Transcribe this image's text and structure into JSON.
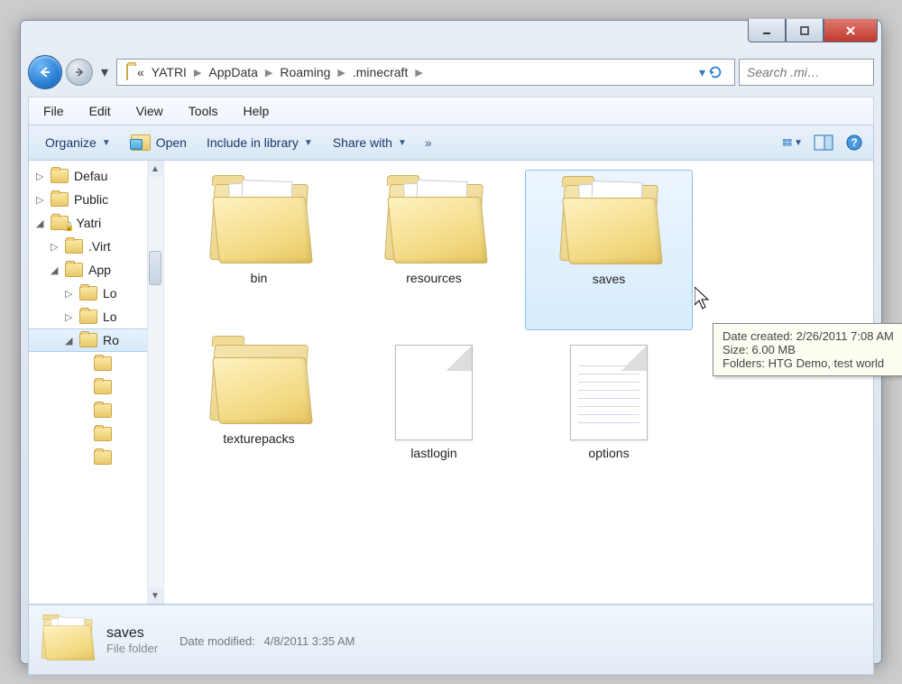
{
  "window_controls": {
    "min": "_",
    "max": "▭",
    "close": "X"
  },
  "breadcrumbs": [
    "YATRI",
    "AppData",
    "Roaming",
    ".minecraft"
  ],
  "breadcrumb_prefix": "«",
  "search": {
    "placeholder": "Search .mi…"
  },
  "menus": {
    "file": "File",
    "edit": "Edit",
    "view": "View",
    "tools": "Tools",
    "help": "Help"
  },
  "toolbar": {
    "organize": "Organize",
    "open": "Open",
    "include": "Include in library",
    "share": "Share with",
    "overflow": "»"
  },
  "sidebar": {
    "items": [
      {
        "label": "Defau",
        "indent": 0,
        "open": false
      },
      {
        "label": "Public",
        "indent": 0,
        "open": false
      },
      {
        "label": "Yatri",
        "indent": 0,
        "open": true,
        "locked": true
      },
      {
        "label": ".Virt",
        "indent": 1,
        "open": false
      },
      {
        "label": "App",
        "indent": 1,
        "open": true
      },
      {
        "label": "Lo",
        "indent": 2,
        "open": false
      },
      {
        "label": "Lo",
        "indent": 2,
        "open": false
      },
      {
        "label": "Ro",
        "indent": 2,
        "open": true,
        "selected": true
      },
      {
        "label": "",
        "indent": 3,
        "open": false
      },
      {
        "label": "",
        "indent": 3,
        "open": false
      },
      {
        "label": "",
        "indent": 3,
        "open": false
      },
      {
        "label": "",
        "indent": 3,
        "open": false
      },
      {
        "label": "",
        "indent": 3,
        "open": false
      }
    ]
  },
  "files": [
    {
      "name": "bin",
      "type": "folder",
      "sheets": true
    },
    {
      "name": "resources",
      "type": "folder",
      "sheets": true
    },
    {
      "name": "saves",
      "type": "folder",
      "sheets": true,
      "selected": true
    },
    {
      "name": "texturepacks",
      "type": "folder",
      "sheets": false
    },
    {
      "name": "lastlogin",
      "type": "file",
      "lined": false
    },
    {
      "name": "options",
      "type": "file",
      "lined": true
    }
  ],
  "tooltip": {
    "line1": "Date created: 2/26/2011 7:08 AM",
    "line2": "Size: 6.00 MB",
    "line3": "Folders: HTG Demo, test world"
  },
  "details": {
    "name": "saves",
    "name_label": "saves",
    "type": "File folder",
    "modified_label": "Date modified:",
    "modified_value": "4/8/2011 3:35 AM"
  }
}
